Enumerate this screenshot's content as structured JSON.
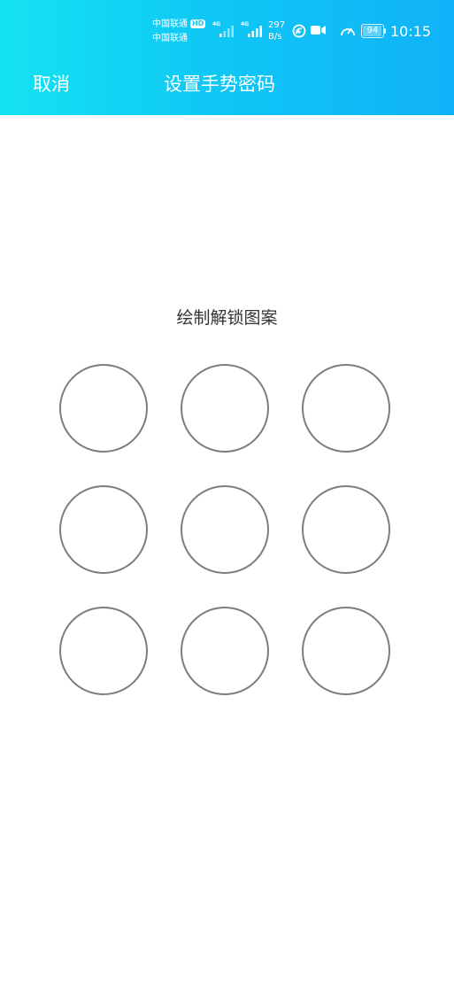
{
  "status_bar": {
    "carrier_1": "中国联通",
    "carrier_2": "中国联通",
    "hd_badge": "HD",
    "sim1_network": "4G",
    "sim2_network": "4G",
    "net_speed_value": "297",
    "net_speed_unit": "B/s",
    "battery_level": "94",
    "battery_fraction": 0.94,
    "time": "10:15",
    "icons": [
      "hd-voice-icon",
      "signal-icon",
      "signal-icon",
      "nfc-icon",
      "video-camera-icon",
      "speedometer-icon",
      "battery-icon"
    ]
  },
  "nav": {
    "cancel_label": "取消",
    "title": "设置手势密码"
  },
  "content": {
    "instruction": "绘制解锁图案",
    "pattern_points": 9
  },
  "colors": {
    "header_gradient_start": "#14e3f2",
    "header_gradient_end": "#10b2f7",
    "dot_border": "#7d7d7d",
    "instruction_text": "#333333"
  }
}
